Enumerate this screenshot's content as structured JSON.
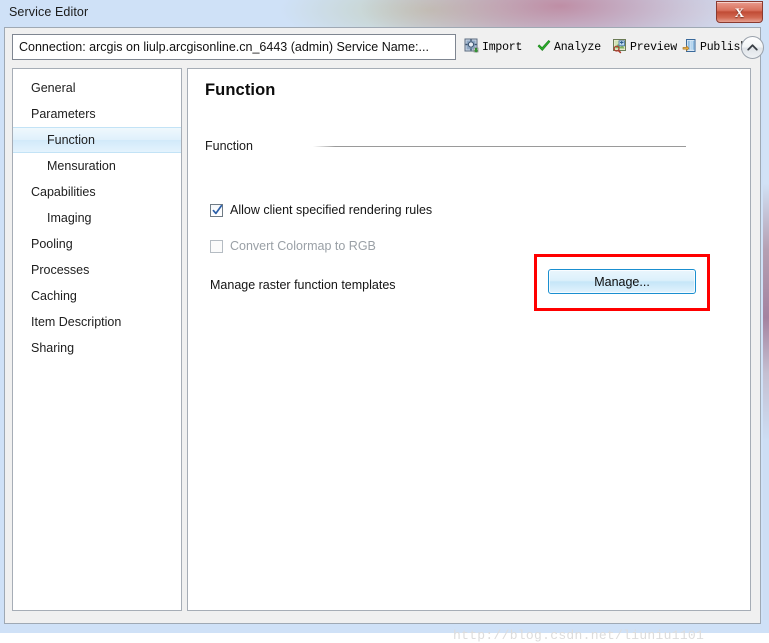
{
  "window": {
    "title": "Service Editor",
    "close_label": "X"
  },
  "toolbar": {
    "connection_value": "Connection: arcgis on liulp.arcgisonline.cn_6443 (admin)   Service Name:...",
    "connection_placeholder": "Connection:",
    "buttons": [
      {
        "label": "Import",
        "icon": "import-icon"
      },
      {
        "label": "Analyze",
        "icon": "check-icon"
      },
      {
        "label": "Preview",
        "icon": "preview-icon"
      },
      {
        "label": "Publish",
        "icon": "publish-icon"
      }
    ],
    "collapse_icon": "chevron-up-icon"
  },
  "sidebar": {
    "items": [
      {
        "label": "General",
        "indent": false,
        "selected": false
      },
      {
        "label": "Parameters",
        "indent": false,
        "selected": false
      },
      {
        "label": "Function",
        "indent": true,
        "selected": true
      },
      {
        "label": "Mensuration",
        "indent": true,
        "selected": false
      },
      {
        "label": "Capabilities",
        "indent": false,
        "selected": false
      },
      {
        "label": "Imaging",
        "indent": true,
        "selected": false
      },
      {
        "label": "Pooling",
        "indent": false,
        "selected": false
      },
      {
        "label": "Processes",
        "indent": false,
        "selected": false
      },
      {
        "label": "Caching",
        "indent": false,
        "selected": false
      },
      {
        "label": "Item Description",
        "indent": false,
        "selected": false
      },
      {
        "label": "Sharing",
        "indent": false,
        "selected": false
      }
    ]
  },
  "main": {
    "title": "Function",
    "group_label": "Function",
    "checkbox_allow": {
      "label": "Allow client specified rendering rules",
      "checked": true,
      "disabled": false
    },
    "checkbox_convert": {
      "label": "Convert Colormap to RGB",
      "checked": false,
      "disabled": true
    },
    "manage_row_label": "Manage raster function templates",
    "manage_button_label": "Manage...",
    "highlight_color": "#ff0000"
  },
  "watermark": {
    "text": "http://blog.csdn.net/liuniu1101"
  },
  "colors": {
    "accent_blue": "#1a8fd0",
    "selection_blue": "#d2eafa",
    "highlight_red": "#ff0000",
    "close_red": "#c14b35"
  }
}
